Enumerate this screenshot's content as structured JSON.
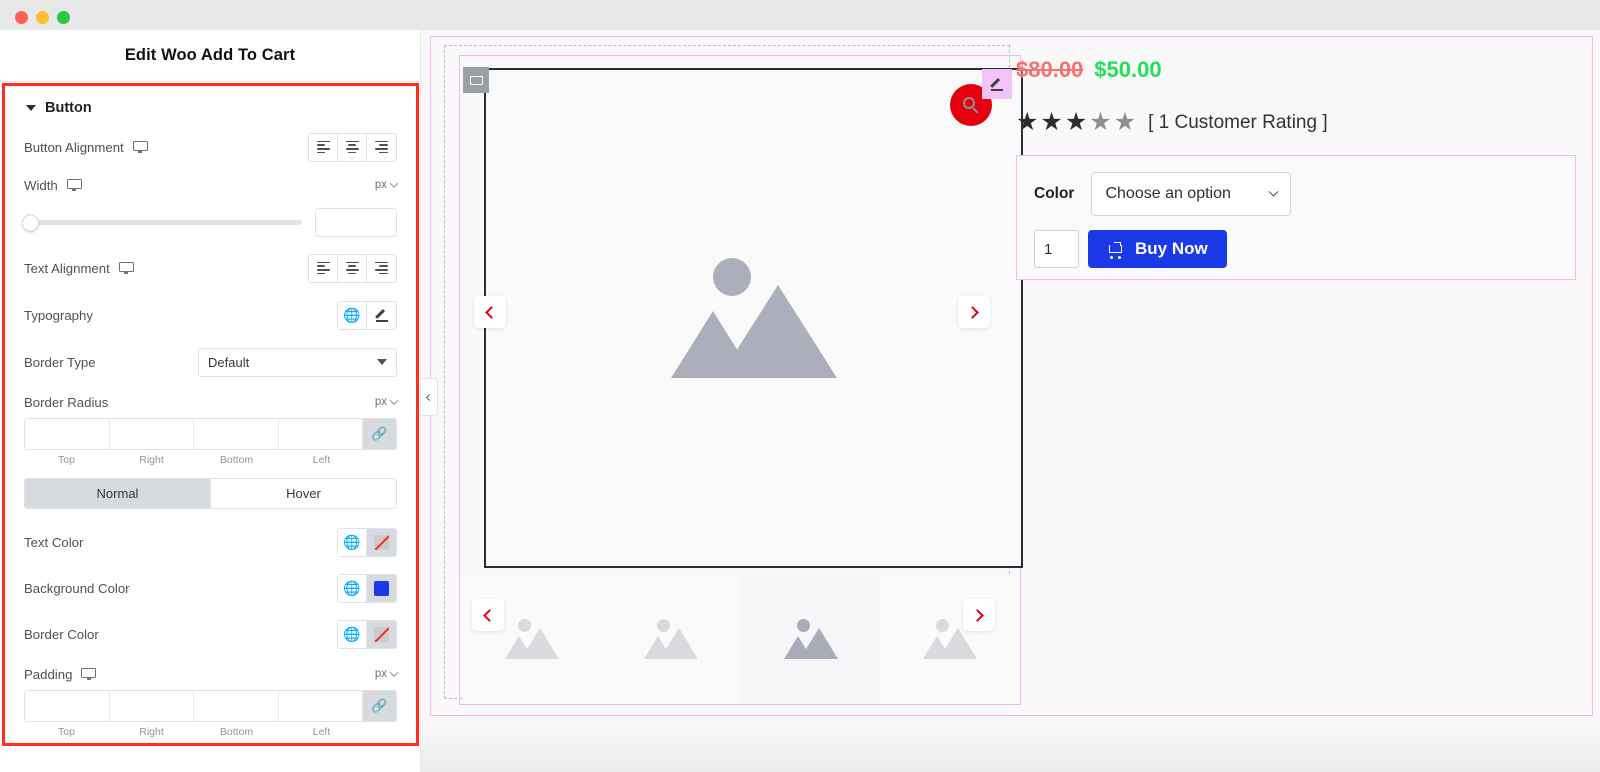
{
  "window": {
    "lights": [
      "close",
      "minimize",
      "maximize"
    ]
  },
  "panel": {
    "title": "Edit Woo Add To Cart",
    "section": {
      "label": "Button"
    },
    "controls": {
      "button_alignment": {
        "label": "Button Alignment",
        "device": "desktop",
        "options": [
          "align-left",
          "align-center",
          "align-right"
        ]
      },
      "width": {
        "label": "Width",
        "device": "desktop",
        "unit": "px",
        "value": "",
        "slider_value": 0
      },
      "text_alignment": {
        "label": "Text Alignment",
        "device": "desktop",
        "options": [
          "align-left",
          "align-center",
          "align-right"
        ]
      },
      "typography": {
        "label": "Typography",
        "icons": [
          "globe-icon",
          "pencil-icon"
        ]
      },
      "border_type": {
        "label": "Border Type",
        "value": "Default"
      },
      "border_radius": {
        "label": "Border Radius",
        "unit": "px",
        "values": [
          "",
          "",
          "",
          ""
        ],
        "sides": [
          "Top",
          "Right",
          "Bottom",
          "Left"
        ],
        "linked": true
      },
      "state_tabs": {
        "items": [
          "Normal",
          "Hover"
        ],
        "active": "Normal"
      },
      "text_color": {
        "label": "Text Color",
        "value": "none"
      },
      "background_color": {
        "label": "Background Color",
        "value": "#1a3ae8"
      },
      "border_color": {
        "label": "Border Color",
        "value": "none"
      },
      "padding": {
        "label": "Padding",
        "device": "desktop",
        "unit": "px",
        "values": [
          "",
          "",
          "",
          ""
        ],
        "sides": [
          "Top",
          "Right",
          "Bottom",
          "Left"
        ],
        "linked": true
      }
    }
  },
  "canvas": {
    "collapse_handle": "collapse-panel",
    "widget_handle": "widget-handle-icon",
    "edit_badge": "pencil-icon",
    "zoom_button": "search-icon",
    "gallery": {
      "main_image_alt": "image-placeholder",
      "prev_label": "previous-image",
      "next_label": "next-image",
      "thumbnails": [
        {
          "alt": "image-placeholder",
          "active": false
        },
        {
          "alt": "image-placeholder",
          "active": false
        },
        {
          "alt": "image-placeholder",
          "active": true
        },
        {
          "alt": "image-placeholder",
          "active": false
        }
      ]
    },
    "product": {
      "price_old": "$80.00",
      "price_new": "$50.00",
      "rating": {
        "filled": 3,
        "total": 5,
        "text": "[ 1 Customer Rating ]"
      },
      "attribute": {
        "label": "Color",
        "value": "Choose an option"
      },
      "quantity": "1",
      "buy_button": "Buy Now"
    }
  },
  "colors": {
    "accent_red": "#ff2d20",
    "button_blue": "#1a3ae8",
    "price_old": "#f87171",
    "price_new": "#22e058",
    "pink_outline": "#f3b8f5"
  }
}
